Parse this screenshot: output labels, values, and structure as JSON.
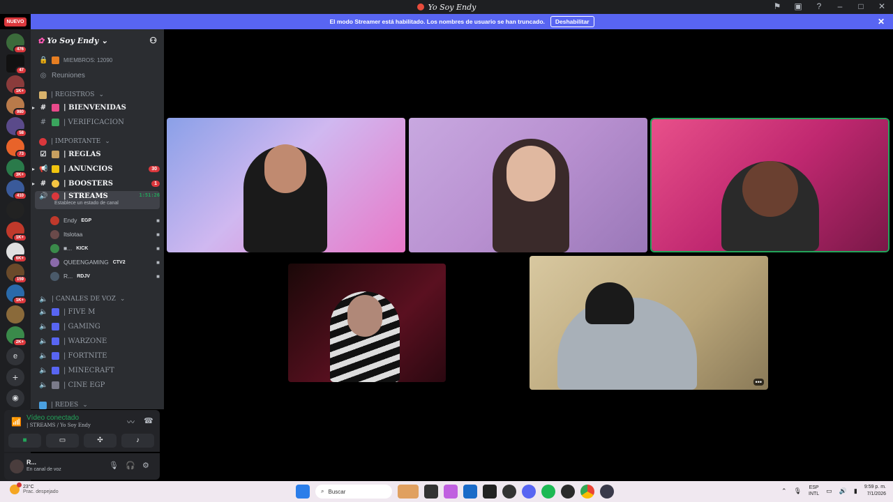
{
  "window": {
    "title": "Yo Soy Endy"
  },
  "banner": {
    "text": "El modo Streamer está habilitado. Los nombres de usuario se han truncado.",
    "button": "Deshabilitar"
  },
  "nuevo_label": "NUEVO",
  "server_badges": [
    "476",
    "47",
    "1K+",
    "980",
    "58",
    "73",
    "3K+",
    "410",
    "1K+",
    "6K+",
    "159",
    "1K+",
    "2K+"
  ],
  "server_icon_e": "e",
  "server": {
    "name": "Yo Soy Endy",
    "members": "MIEMBROS: 12090",
    "meetings": "Reuniones",
    "categories": {
      "registros": "| REGISTROS",
      "importante": "| IMPORTANTE",
      "canales_voz": "| CANALES DE VOZ",
      "redes": "| REDES"
    },
    "channels": {
      "bienvenidas": "| BIENVENIDAS",
      "verificacion": "| VERIFICACION",
      "reglas": "| REGLAS",
      "anuncios": "| ANUNCIOS",
      "anuncios_count": "30",
      "boosters": "| BOOSTERS",
      "boosters_count": "1",
      "streams": "| STREAMS",
      "streams_timer": "1:51:26",
      "streams_status": "Establece un estado de canal",
      "five_m": "| FIVE M",
      "gaming": "| GAMING",
      "warzone": "| WARZONE",
      "fortnite": "| FORTNITE",
      "minecraft": "| MINECRAFT",
      "cine_egp": "| CINE EGP"
    },
    "voice_users": [
      {
        "name": "Endy",
        "tag": "EGP"
      },
      {
        "name": "Itslotaa",
        "tag": ""
      },
      {
        "name": "■...",
        "tag": "KICK"
      },
      {
        "name": "QUEENGAMING",
        "tag": "CTV2"
      },
      {
        "name": "R...",
        "tag": "RDJV"
      }
    ]
  },
  "voice_panel": {
    "status": "Vídeo conectado",
    "location": "| STREAMS / Yo Soy Endy"
  },
  "user_panel": {
    "name": "R...",
    "status": "En canal de voz"
  },
  "taskbar": {
    "weather_temp": "23°C",
    "weather_desc": "Prac. despejado",
    "search": "Buscar",
    "lang_1": "ESP",
    "lang_2": "INTL",
    "time": "9:59 p. m.",
    "date": "7/1/2026"
  }
}
